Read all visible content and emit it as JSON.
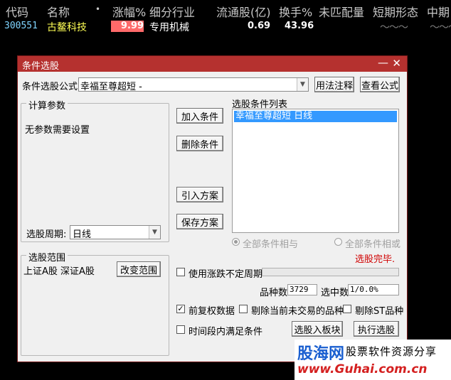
{
  "table": {
    "headers": [
      "代码",
      "名称",
      "•",
      "涨幅%",
      "细分行业",
      "流通股(亿)",
      "换手%",
      "未匹配量",
      "短期形态",
      "中期"
    ],
    "row": {
      "code": "300551",
      "name": "古鳌科技",
      "change": "9.99",
      "industry": "专用机械",
      "float_shares": "0.69",
      "turnover": "43.96",
      "wave1": "〜〜〜",
      "wave2": "〜〜〜"
    }
  },
  "dialog": {
    "title": "条件选股",
    "minimize": "—",
    "close": "✕",
    "formula_label": "条件选股公式",
    "formula_value": "幸福至尊超短 -",
    "usage_button": "用法注释",
    "view_formula_button": "查看公式",
    "params_group": "计算参数",
    "params_text": "无参数需要设置",
    "period_label": "选股周期:",
    "period_value": "日线",
    "add_button": "加入条件",
    "delete_button": "删除条件",
    "import_button": "引入方案",
    "save_button": "保存方案",
    "list_label": "选股条件列表",
    "list_items": [
      "幸福至尊超短  日线"
    ],
    "radio_and": "全部条件相与",
    "radio_or": "全部条件相或",
    "status": "选股完毕.",
    "scope_group": "选股范围",
    "scope_text": "上证A股 深证A股",
    "change_scope_button": "改变范围",
    "use_uncertain_period": "使用涨跌不定周期",
    "variety_count_label": "品种数",
    "variety_count": "3729",
    "selected_count_label": "选中数",
    "selected_count": "1/0.0%",
    "pre_adjust": "前复权数据",
    "exclude_untraded": "剔除当前未交易的品种",
    "exclude_st": "剔除ST品种",
    "time_range": "时间段内满足条件",
    "to_board_button": "选股入板块",
    "execute_button": "执行选股"
  },
  "watermark": {
    "brand": "股海网",
    "slogan": "股票软件资源分享",
    "url": "www.Guhai.com.cn"
  },
  "colors": {
    "title_bar": "#b5312f",
    "code": "#7fd4ff",
    "name": "#ffff55",
    "change_bg": "#ff6a6a",
    "status": "#d00000"
  }
}
